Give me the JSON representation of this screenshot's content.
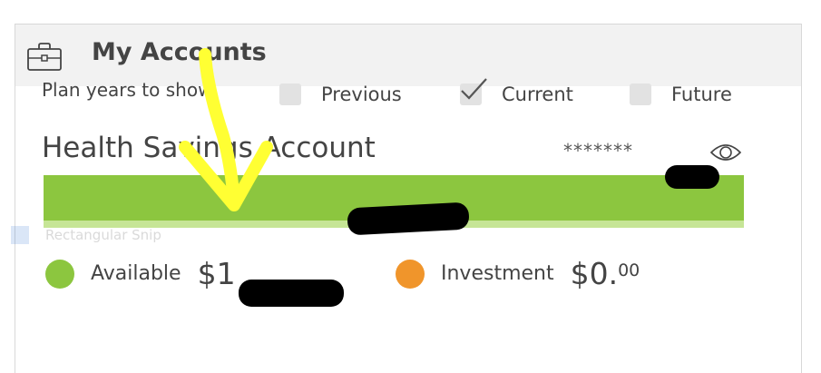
{
  "header": {
    "title": "My Accounts",
    "icon": "briefcase-icon"
  },
  "plan_years": {
    "label": "Plan years to show:",
    "options": [
      {
        "label": "Previous",
        "checked": false
      },
      {
        "label": "Current",
        "checked": true
      },
      {
        "label": "Future",
        "checked": false
      }
    ]
  },
  "account": {
    "name": "Health Savings Account",
    "masked_number": "*******"
  },
  "legend": {
    "available": {
      "label": "Available",
      "value_prefix": "$1",
      "color": "#8cc63f"
    },
    "investment": {
      "label": "Investment",
      "value_main": "$0.",
      "value_cents": "00",
      "color": "#f0952b"
    }
  },
  "overlay": {
    "snip_label": "Rectangular Snip"
  },
  "colors": {
    "bar": "#8cc63f",
    "bar_light": "#c6e596",
    "header_bg": "#f2f2f2",
    "annotation_arrow": "#ffff33"
  }
}
